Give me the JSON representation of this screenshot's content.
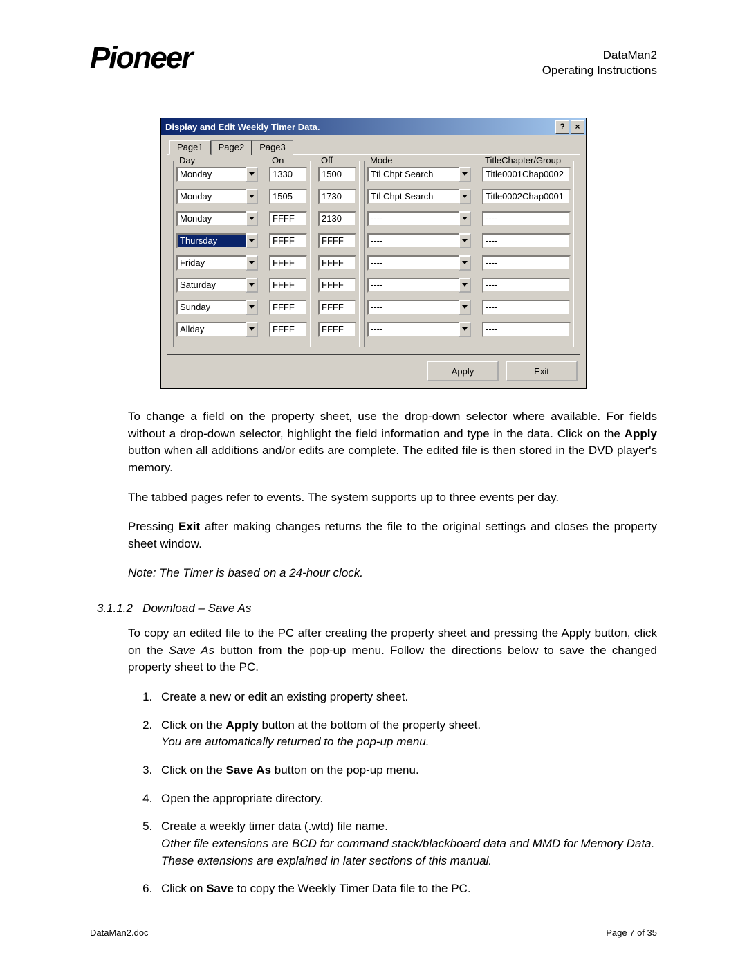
{
  "header": {
    "logo_text": "Pioneer",
    "title1": "DataMan2",
    "title2": "Operating Instructions"
  },
  "dialog": {
    "title": "Display and Edit Weekly Timer Data.",
    "help_btn": "?",
    "close_btn": "×",
    "tabs": [
      "Page1",
      "Page2",
      "Page3"
    ],
    "groups": {
      "day": "Day",
      "on": "On",
      "off": "Off",
      "mode": "Mode",
      "tcg": "TitleChapter/Group"
    },
    "rows": [
      {
        "day": "Monday",
        "on": "1330",
        "off": "1500",
        "mode": "Ttl Chpt Search",
        "tcg": "Title0001Chap0002",
        "hl": false
      },
      {
        "day": "Monday",
        "on": "1505",
        "off": "1730",
        "mode": "Ttl Chpt Search",
        "tcg": "Title0002Chap0001",
        "hl": false
      },
      {
        "day": "Monday",
        "on": "FFFF",
        "off": "2130",
        "mode": "----",
        "tcg": "----",
        "hl": false
      },
      {
        "day": "Thursday",
        "on": "FFFF",
        "off": "FFFF",
        "mode": "----",
        "tcg": "----",
        "hl": true
      },
      {
        "day": "Friday",
        "on": "FFFF",
        "off": "FFFF",
        "mode": "----",
        "tcg": "----",
        "hl": false
      },
      {
        "day": "Saturday",
        "on": "FFFF",
        "off": "FFFF",
        "mode": "----",
        "tcg": "----",
        "hl": false
      },
      {
        "day": "Sunday",
        "on": "FFFF",
        "off": "FFFF",
        "mode": "----",
        "tcg": "----",
        "hl": false
      },
      {
        "day": "Allday",
        "on": "FFFF",
        "off": "FFFF",
        "mode": "----",
        "tcg": "----",
        "hl": false
      }
    ],
    "apply": "Apply",
    "exit": "Exit"
  },
  "paras": {
    "p1a": "To change a field on the property sheet, use the drop-down selector where available. For fields without a drop-down selector, highlight the field information and type in the data.  Click on the ",
    "p1b": "Apply",
    "p1c": " button when all additions and/or edits are complete.  The edited file is then stored in the DVD player's memory.",
    "p2": "The tabbed pages refer to events.  The system supports up to three events per day.",
    "p3a": "Pressing ",
    "p3b": "Exit",
    "p3c": " after making changes returns the file to the original settings and closes the property sheet window.",
    "note": "Note: The Timer is based on a 24-hour clock."
  },
  "section": {
    "num": "3.1.1.2",
    "title": "Download – Save As"
  },
  "p_intro_a": "To copy an edited file to the PC after creating the property sheet and pressing the Apply button, click on the ",
  "p_intro_b": "Save As",
  "p_intro_c": " button from the pop-up menu.  Follow the directions below to save the changed property sheet to the PC.",
  "steps": [
    {
      "t": "Create a new or edit an existing property sheet."
    },
    {
      "t_a": "Click on the ",
      "t_b": "Apply",
      "t_c": " button at the bottom of the property sheet.",
      "it": "You are automatically returned to the pop-up menu."
    },
    {
      "t_a": "Click on the ",
      "t_b": "Save As",
      "t_c": " button on the pop-up menu."
    },
    {
      "t": "Open the appropriate directory."
    },
    {
      "t": "Create a weekly timer data (.wtd) file name.",
      "it": "Other file extensions are BCD for command stack/blackboard data and MMD for Memory Data.  These extensions are explained in later sections of this manual."
    },
    {
      "t_a": "Click on ",
      "t_b": "Save",
      "t_c": " to copy the Weekly Timer Data file to the PC."
    }
  ],
  "footer": {
    "left": "DataMan2.doc",
    "right": "Page 7 of 35"
  }
}
